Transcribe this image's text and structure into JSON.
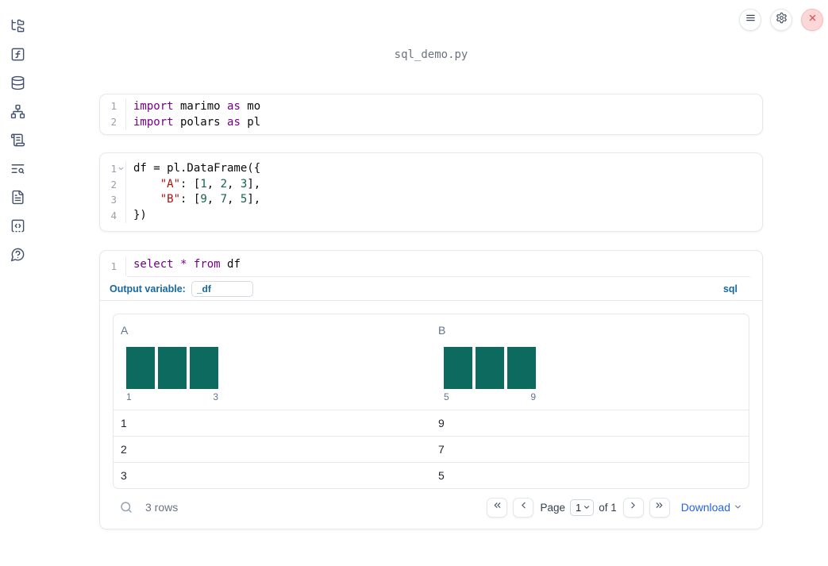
{
  "chrome": {
    "title": "sql_demo.py",
    "buttons": {
      "menu": "hamburger-menu",
      "settings": "gear",
      "close": "shutdown-x"
    }
  },
  "sidebar": {
    "items": [
      {
        "icon": "folder-tree-icon",
        "label": "file-explorer"
      },
      {
        "icon": "function-square-icon",
        "label": "variables"
      },
      {
        "icon": "database-icon",
        "label": "data-sources"
      },
      {
        "icon": "network-icon",
        "label": "dependency-graph"
      },
      {
        "icon": "scroll-text-icon",
        "label": "logs"
      },
      {
        "icon": "text-search-icon",
        "label": "outline"
      },
      {
        "icon": "file-text-icon",
        "label": "documentation"
      },
      {
        "icon": "code-square-icon",
        "label": "snippets"
      },
      {
        "icon": "message-question-icon",
        "label": "help"
      }
    ]
  },
  "cells": {
    "imports": {
      "lines": [
        {
          "num": "1",
          "kw1": "import",
          "id1": " marimo ",
          "kw2": "as",
          "id2": " mo"
        },
        {
          "num": "2",
          "kw1": "import",
          "id1": " polars ",
          "kw2": "as",
          "id2": " pl"
        }
      ]
    },
    "dataframe": {
      "line1": {
        "num": "1",
        "code": "df = pl.DataFrame({"
      },
      "line2": {
        "num": "2",
        "indent": "    ",
        "str": "\"A\"",
        "p1": ": [",
        "n1": "1",
        "s1": ", ",
        "n2": "2",
        "s2": ", ",
        "n3": "3",
        "p2": "],"
      },
      "line3": {
        "num": "3",
        "indent": "    ",
        "str": "\"B\"",
        "p1": ": [",
        "n1": "9",
        "s1": ", ",
        "n2": "7",
        "s2": ", ",
        "n3": "5",
        "p2": "],"
      },
      "line4": {
        "num": "4",
        "code": "})"
      }
    },
    "sql": {
      "num": "1",
      "kw1": "select",
      "sp1": " ",
      "star": "*",
      "sp2": " ",
      "kw2": "from",
      "id": " df",
      "output_variable_label": "Output variable:",
      "output_variable_value": "_df",
      "language_badge": "sql"
    }
  },
  "table": {
    "columns": [
      {
        "name": "A",
        "histogram": {
          "bar_values": [
            1,
            1,
            1
          ],
          "min_label": "1",
          "max_label": "3"
        }
      },
      {
        "name": "B",
        "histogram": {
          "bar_values": [
            1,
            1,
            1
          ],
          "min_label": "5",
          "max_label": "9"
        }
      }
    ],
    "rows": [
      [
        "1",
        "9"
      ],
      [
        "2",
        "7"
      ],
      [
        "3",
        "5"
      ]
    ],
    "footer": {
      "row_count": "3 rows",
      "search_icon": "search-icon",
      "pagination": {
        "first_icon": "chevrons-left-icon",
        "prev_icon": "chevron-left-icon",
        "page_label": "Page",
        "page_value": "1",
        "of_label": "of 1",
        "next_icon": "chevron-right-icon",
        "last_icon": "chevrons-right-icon"
      },
      "download_label": "Download",
      "download_icon": "chevron-down-icon"
    }
  },
  "colors": {
    "histogram_bar": "#0d6a5e",
    "accent_blue": "#17689e",
    "link_blue": "#2563eb",
    "keyword": "#770088",
    "string": "#aa1111",
    "number": "#116644",
    "close_button_bg": "#fbd7d7",
    "close_button_fg": "#d95454"
  }
}
